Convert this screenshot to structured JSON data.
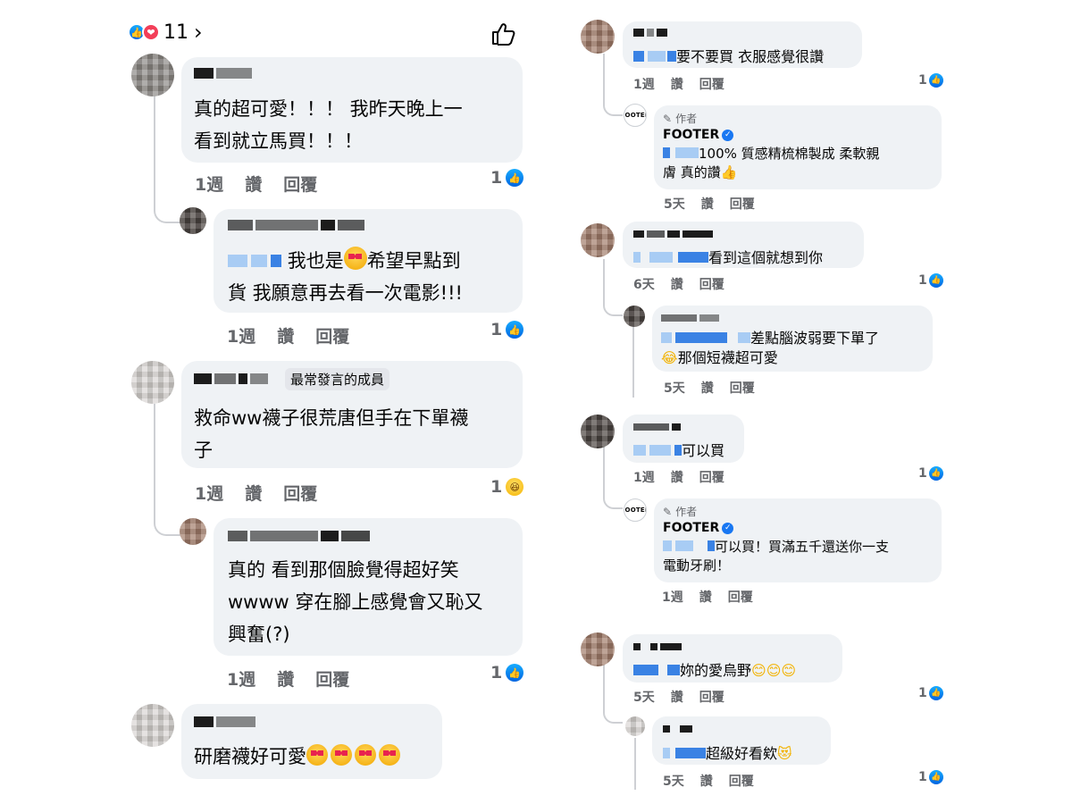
{
  "header": {
    "reaction_count": "11",
    "like_label": "讚"
  },
  "left": {
    "c1": {
      "text": "真的超可愛！！！ 我昨天晚上一\n看到就立馬買！！！",
      "time": "1週",
      "like": "讚",
      "reply": "回覆",
      "count": "1"
    },
    "c2": {
      "text_a": "我也是",
      "text_b": "希望早點到",
      "text_c": "貨 我願意再去看一次電影!!!",
      "time": "1週",
      "like": "讚",
      "reply": "回覆",
      "count": "1"
    },
    "c3": {
      "badge": "最常發言的成員",
      "text": "救命ww襪子很荒唐但手在下單襪\n子",
      "time": "1週",
      "like": "讚",
      "reply": "回覆",
      "count": "1"
    },
    "c4": {
      "text": "真的 看到那個臉覺得超好笑\nwwww 穿在腳上感覺會又恥又\n興奮(?)",
      "time": "1週",
      "like": "讚",
      "reply": "回覆",
      "count": "1"
    },
    "c5": {
      "text": "研磨襪好可愛"
    }
  },
  "right": {
    "r1": {
      "text": "要不要買 衣服感覺很讚",
      "time": "1週",
      "like": "讚",
      "reply": "回覆",
      "count": "1"
    },
    "r1a": {
      "author_tag": "作者",
      "name": "FOOTER",
      "logo": "FOOTER",
      "text_a": "100% 質感精梳棉製成 柔軟親",
      "text_b": "膚 真的讚",
      "time": "5天",
      "like": "讚",
      "reply": "回覆"
    },
    "r2": {
      "text": "看到這個就想到你",
      "time": "6天",
      "like": "讚",
      "reply": "回覆",
      "count": "1"
    },
    "r2a": {
      "text_a": "差點腦波弱要下單了",
      "text_b": "那個短襪超可愛",
      "time": "5天",
      "like": "讚",
      "reply": "回覆"
    },
    "r3": {
      "text": "可以買",
      "time": "1週",
      "like": "讚",
      "reply": "回覆",
      "count": "1"
    },
    "r3a": {
      "author_tag": "作者",
      "name": "FOOTER",
      "logo": "FOOTER",
      "text_a": "可以買！買滿五千還送你一支",
      "text_b": "電動牙刷！",
      "time": "1週",
      "like": "讚",
      "reply": "回覆"
    },
    "r4": {
      "text": "妳的愛烏野",
      "time": "5天",
      "like": "讚",
      "reply": "回覆",
      "count": "1"
    },
    "r4a": {
      "text": "超級好看欸",
      "time": "5天",
      "like": "讚",
      "reply": "回覆",
      "count": "1"
    }
  }
}
